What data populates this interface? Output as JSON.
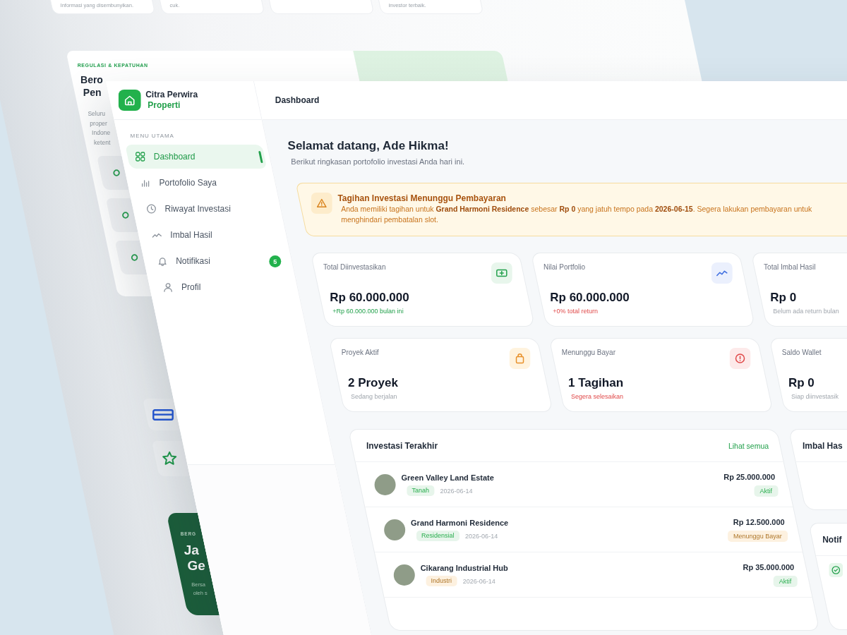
{
  "background_page": {
    "info_cards": [
      {
        "kind": "text",
        "text": "Informasi yang disembunyikan."
      },
      {
        "kind": "text",
        "text": "cuk."
      },
      {
        "kind": "empty"
      },
      {
        "kind": "text",
        "text": "investor terbaik."
      }
    ],
    "section": {
      "label": "REGULASI & KEPATUHAN",
      "title_lines": [
        "Bero",
        "Pen"
      ],
      "text_lines": [
        "Seluru",
        "proper",
        "Indone",
        "ketent"
      ],
      "list_items": [
        {
          "kind": "circle"
        },
        {
          "kind": "circle"
        },
        {
          "kind": "circle"
        }
      ]
    },
    "features": [
      {
        "kind": "card"
      },
      {
        "kind": "star"
      }
    ],
    "promo": {
      "label": "BERG",
      "title_lines": [
        "Ja",
        "Ge"
      ],
      "text_lines": [
        "Bersa",
        "oleh s"
      ]
    }
  },
  "sidebar": {
    "brand": {
      "name": "Citra Perwira",
      "subtitle": "Properti"
    },
    "menu_heading": "MENU UTAMA",
    "items": [
      {
        "label": "Dashboard",
        "kind": "grid",
        "selected": true
      },
      {
        "label": "Portofolio Saya",
        "kind": "bars",
        "selected": false
      },
      {
        "label": "Riwayat Investasi",
        "kind": "clock",
        "selected": false
      },
      {
        "label": "Imbal Hasil",
        "kind": "trend",
        "selected": false
      },
      {
        "label": "Notifikasi",
        "kind": "bell",
        "selected": false,
        "badge": "5"
      },
      {
        "label": "Profil",
        "kind": "user",
        "selected": false
      }
    ]
  },
  "header": {
    "title": "Dashboard"
  },
  "welcome": {
    "title": "Selamat datang, Ade Hikma!",
    "subtitle": "Berikut ringkasan portofolio investasi Anda hari ini."
  },
  "alert": {
    "title": "Tagihan Investasi Menunggu Pembayaran",
    "message": "Anda memiliki tagihan untuk **Grand Harmoni Residence** sebesar **Rp 0** yang jatuh tempo pada **2026-06-15**. Segera lakukan pembayaran untuk menghindari pembatalan slot."
  },
  "stats": [
    {
      "label": "Total Diinvestasikan",
      "value": "Rp 60.000.000",
      "note": "+Rp 60.000.000 bulan ini",
      "positive": true,
      "negative": false,
      "kind": "cash"
    },
    {
      "label": "Nilai Portfolio",
      "value": "Rp 60.000.000",
      "note": "+0% total return",
      "positive": false,
      "negative": true,
      "kind": "trend"
    },
    {
      "label": "Total Imbal Hasil",
      "value": "Rp 0",
      "note": "Belum ada return bulan",
      "positive": false,
      "negative": false,
      "kind": "plain"
    },
    {
      "label": "Proyek Aktif",
      "value": "2 Proyek",
      "note": "Sedang berjalan",
      "positive": false,
      "negative": false,
      "kind": "bag"
    },
    {
      "label": "Menunggu Bayar",
      "value": "1 Tagihan",
      "note": "Segera selesaikan",
      "positive": false,
      "negative": true,
      "kind": "alert"
    },
    {
      "label": "Saldo Wallet",
      "value": "Rp 0",
      "note": "Siap diinvestasik",
      "positive": false,
      "negative": false,
      "kind": "plain"
    }
  ],
  "recent_investments": {
    "title": "Investasi Terakhir",
    "link": "Lihat semua",
    "rows": [
      {
        "name": "Green Valley Land Estate",
        "category": {
          "label": "Tanah",
          "color": "#e7f5eb"
        },
        "date": "2026-06-14",
        "amount": "Rp 25.000.000",
        "status": {
          "label": "Aktif",
          "color": "#e7f5eb"
        }
      },
      {
        "name": "Grand Harmoni Residence",
        "category": {
          "label": "Residensial",
          "color": "#e7f5eb"
        },
        "date": "2026-06-14",
        "amount": "Rp 12.500.000",
        "status": {
          "label": "Menunggu Bayar",
          "color": "#fdf1e0"
        }
      },
      {
        "name": "Cikarang Industrial Hub",
        "category": {
          "label": "Industri",
          "color": "#fdf1e0"
        },
        "date": "2026-06-14",
        "amount": "Rp 35.000.000",
        "status": {
          "label": "Aktif",
          "color": "#e7f5eb"
        }
      }
    ]
  },
  "returns_panel": {
    "title": "Imbal Has"
  },
  "notifications_panel": {
    "title": "Notif",
    "items": [
      {
        "kind": "check"
      }
    ]
  }
}
